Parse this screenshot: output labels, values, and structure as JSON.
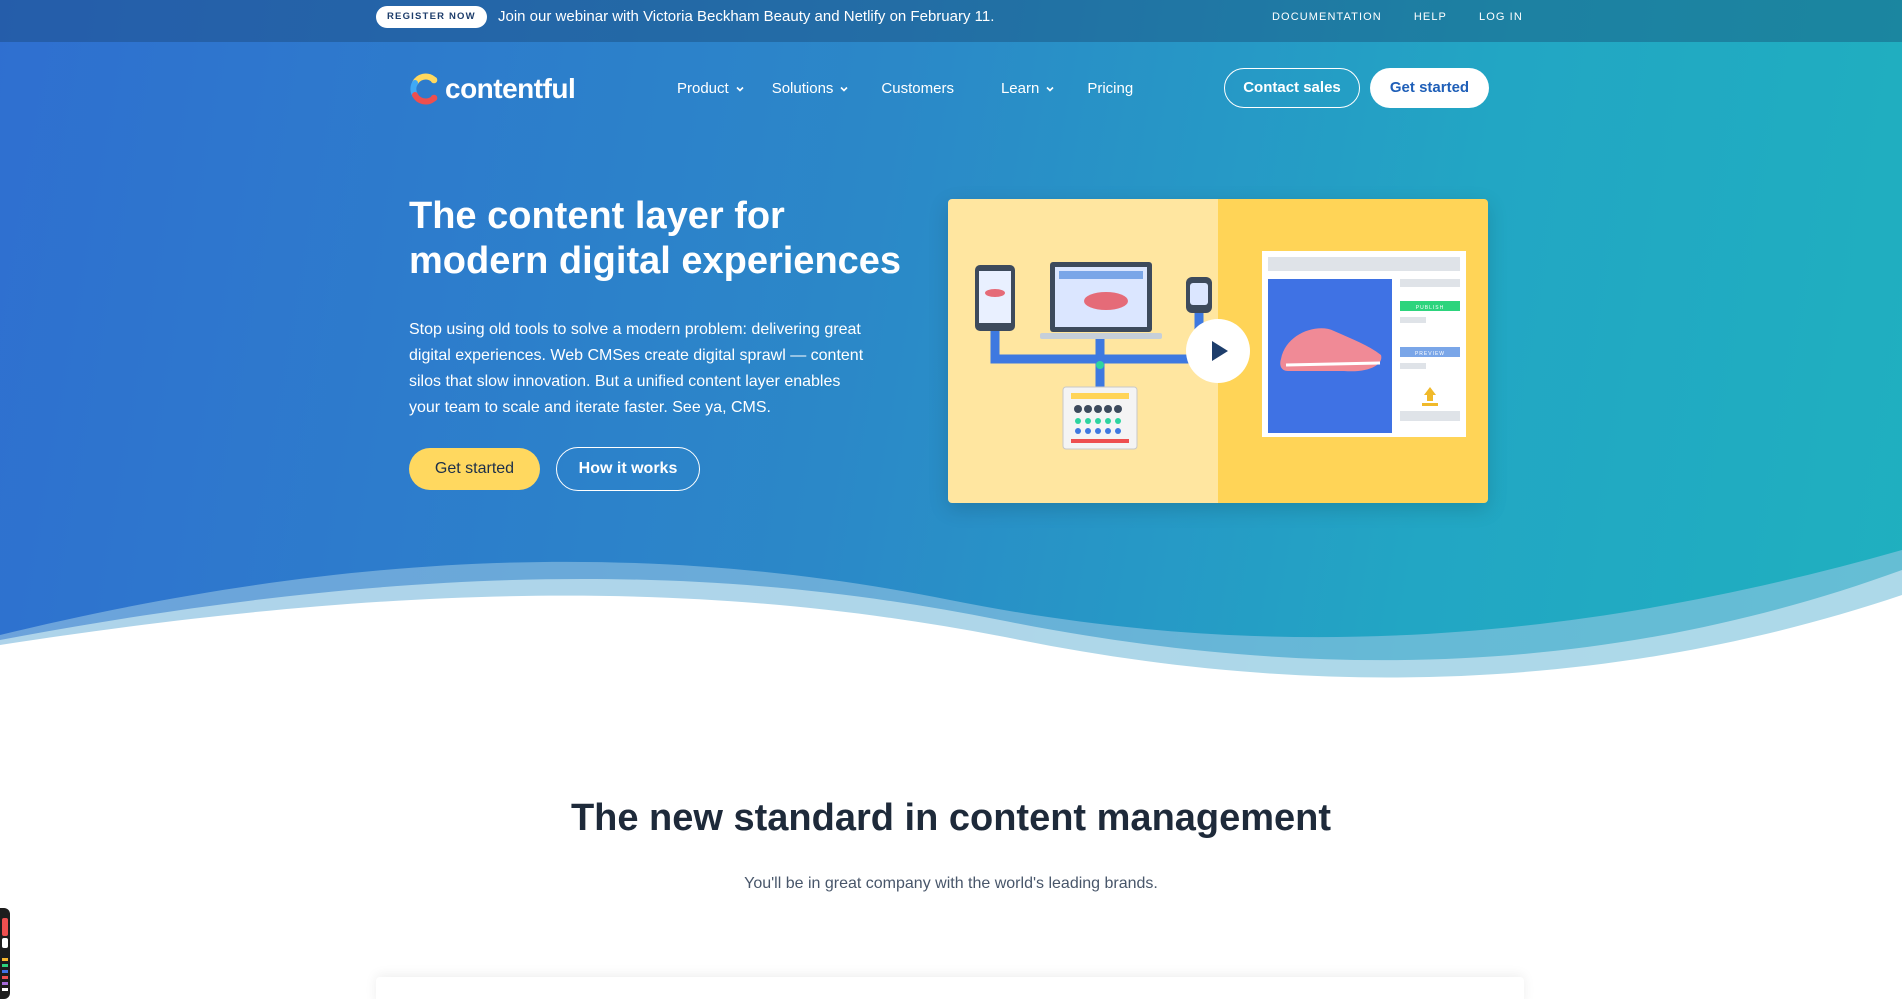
{
  "topbar": {
    "register_label": "REGISTER NOW",
    "announcement": "Join our webinar with Victoria Beckham Beauty and Netlify on February 11.",
    "links": [
      "DOCUMENTATION",
      "HELP",
      "LOG IN"
    ]
  },
  "nav": {
    "logo_text": "contentful",
    "items": [
      {
        "label": "Product"
      },
      {
        "label": "Solutions"
      },
      {
        "label": "Customers"
      },
      {
        "label": "Learn"
      },
      {
        "label": "Pricing"
      }
    ],
    "contact_sales": "Contact sales",
    "get_started": "Get started"
  },
  "hero": {
    "title": "The content layer for modern digital experiences",
    "description": "Stop using old tools to solve a modern problem: delivering great digital experiences. Web CMSes create digital sprawl — content silos that slow innovation. But a unified content layer enables your team to scale and iterate faster. See ya, CMS.",
    "primary_cta": "Get started",
    "secondary_cta": "How it works",
    "video_labels": {
      "publish": "PUBLISH",
      "preview": "PREVIEW"
    }
  },
  "section": {
    "title": "The new standard in content management",
    "subtitle": "You'll be in great company with the world's leading brands."
  },
  "colors": {
    "hero_gradient_start": "#2f6fd0",
    "hero_gradient_end": "#1fb0bf",
    "accent_yellow": "#ffd85f",
    "brand_blue": "#1f5fb8",
    "heading_dark": "#1e2a3a"
  }
}
